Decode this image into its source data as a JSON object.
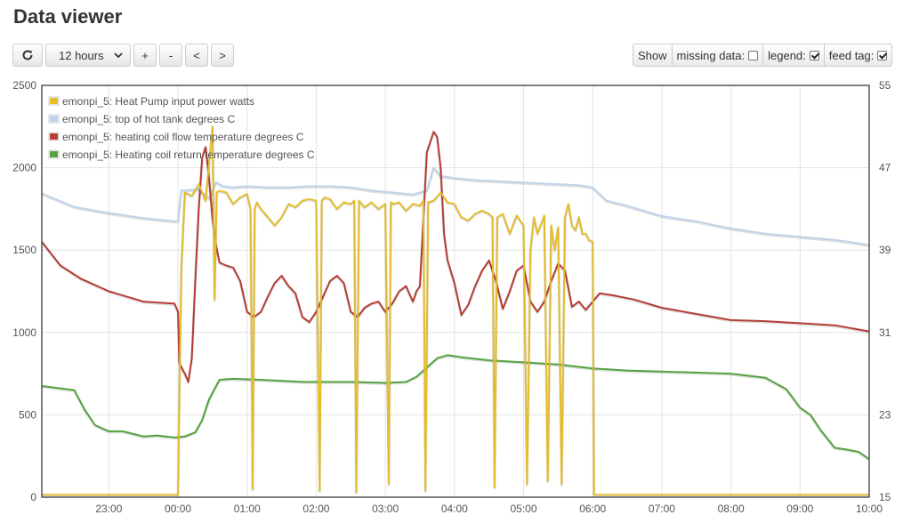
{
  "page": {
    "title": "Data viewer"
  },
  "toolbar": {
    "refresh_icon": "refresh-icon",
    "timespan": "12 hours",
    "zoom_in": "+",
    "zoom_out": "-",
    "pan_left": "<",
    "pan_right": ">"
  },
  "options": {
    "show_label": "Show",
    "missing_data_label": "missing data:",
    "missing_data_checked": false,
    "legend_label": "legend:",
    "legend_checked": true,
    "feed_tag_label": "feed tag:",
    "feed_tag_checked": true
  },
  "chart_data": {
    "type": "line",
    "grid": true,
    "legend_position": "top-left",
    "x_ticks": [
      "23:00",
      "00:00",
      "01:00",
      "02:00",
      "03:00",
      "04:00",
      "05:00",
      "06:00",
      "07:00",
      "08:00",
      "09:00",
      "10:00"
    ],
    "x_tick_hours": [
      -1,
      0,
      1,
      2,
      3,
      4,
      5,
      6,
      7,
      8,
      9,
      10
    ],
    "xlim_hours": [
      -1.97,
      10.0
    ],
    "y_left_ticks": [
      "0",
      "500",
      "1000",
      "1500",
      "2000",
      "2500"
    ],
    "y_left_lim": [
      0,
      2500
    ],
    "y_right_ticks": [
      "15",
      "23",
      "31",
      "39",
      "47",
      "55"
    ],
    "y_right_lim": [
      15,
      55
    ],
    "series": [
      {
        "name": "emonpi_5: Heat Pump input power watts",
        "color": "#e3bd2e",
        "axis": "left",
        "x": [
          -1.97,
          -0.02,
          0.0,
          0.02,
          0.05,
          0.1,
          0.2,
          0.3,
          0.4,
          0.5,
          0.53,
          0.56,
          0.6,
          0.7,
          0.8,
          0.9,
          1.0,
          1.05,
          1.08,
          1.11,
          1.14,
          1.2,
          1.3,
          1.4,
          1.5,
          1.6,
          1.7,
          1.8,
          1.9,
          2.0,
          2.05,
          2.08,
          2.12,
          2.2,
          2.3,
          2.4,
          2.5,
          2.55,
          2.58,
          2.62,
          2.7,
          2.8,
          2.9,
          3.0,
          3.05,
          3.08,
          3.12,
          3.2,
          3.3,
          3.4,
          3.5,
          3.55,
          3.58,
          3.62,
          3.7,
          3.8,
          3.9,
          4.0,
          4.1,
          4.2,
          4.3,
          4.4,
          4.5,
          4.55,
          4.58,
          4.62,
          4.7,
          4.8,
          4.9,
          5.0,
          5.05,
          5.1,
          5.15,
          5.2,
          5.3,
          5.35,
          5.4,
          5.45,
          5.5,
          5.55,
          5.6,
          5.65,
          5.7,
          5.75,
          5.8,
          5.85,
          5.9,
          5.95,
          6.0,
          6.02,
          6.05,
          6.2,
          7.0,
          8.0,
          9.0,
          10.0
        ],
        "y": [
          15,
          15,
          15,
          600,
          1400,
          1850,
          1830,
          1900,
          1800,
          2250,
          1200,
          1850,
          1860,
          1850,
          1780,
          1820,
          1840,
          1750,
          50,
          1750,
          1790,
          1750,
          1700,
          1650,
          1700,
          1780,
          1760,
          1800,
          1810,
          1800,
          40,
          1800,
          1820,
          1810,
          1750,
          1790,
          1780,
          1800,
          30,
          1800,
          1760,
          1790,
          1750,
          1780,
          80,
          1790,
          1780,
          1790,
          1740,
          1780,
          1770,
          1800,
          40,
          1790,
          1800,
          1850,
          1790,
          1780,
          1700,
          1680,
          1720,
          1740,
          1720,
          1700,
          60,
          1700,
          1720,
          1600,
          1710,
          1650,
          80,
          1500,
          1700,
          1600,
          1710,
          100,
          1650,
          1500,
          1640,
          80,
          1700,
          1780,
          1650,
          1620,
          1700,
          1600,
          1600,
          1560,
          1550,
          15,
          15,
          15,
          15,
          15,
          15,
          15
        ]
      },
      {
        "name": "emonpi_5: top of hot tank degrees C",
        "color": "#c0d3ea",
        "axis": "right",
        "x": [
          -1.97,
          -1.5,
          -1.0,
          -0.5,
          -0.05,
          0.0,
          0.05,
          0.3,
          0.45,
          0.55,
          0.65,
          0.8,
          1.0,
          1.3,
          1.6,
          1.9,
          2.2,
          2.5,
          2.8,
          3.1,
          3.4,
          3.6,
          3.7,
          3.8,
          4.0,
          4.3,
          4.6,
          4.9,
          5.2,
          5.5,
          5.8,
          6.0,
          6.2,
          6.5,
          7.0,
          7.5,
          8.0,
          8.5,
          9.0,
          9.5,
          10.0
        ],
        "y": [
          44.5,
          43.2,
          42.6,
          42.1,
          41.8,
          41.8,
          44.8,
          44.9,
          44.0,
          45.6,
          45.2,
          45.1,
          45.2,
          45.1,
          45.1,
          45.2,
          45.2,
          45.1,
          44.8,
          44.6,
          44.4,
          44.8,
          47.0,
          46.2,
          46.0,
          45.8,
          45.7,
          45.6,
          45.5,
          45.4,
          45.3,
          45.1,
          43.8,
          43.3,
          42.3,
          41.8,
          41.1,
          40.6,
          40.3,
          40.0,
          39.5
        ]
      },
      {
        "name": "emonpi_5: heating coil flow temperature degrees C",
        "color": "#b53d35",
        "axis": "right",
        "x": [
          -1.97,
          -1.7,
          -1.4,
          -1.0,
          -0.5,
          -0.05,
          0.0,
          0.02,
          0.1,
          0.15,
          0.2,
          0.25,
          0.3,
          0.35,
          0.4,
          0.45,
          0.5,
          0.55,
          0.6,
          0.7,
          0.8,
          0.9,
          1.0,
          1.1,
          1.2,
          1.3,
          1.4,
          1.5,
          1.6,
          1.7,
          1.8,
          1.9,
          2.0,
          2.1,
          2.2,
          2.3,
          2.4,
          2.5,
          2.6,
          2.7,
          2.8,
          2.9,
          3.0,
          3.1,
          3.2,
          3.3,
          3.4,
          3.45,
          3.5,
          3.6,
          3.7,
          3.75,
          3.8,
          3.85,
          3.9,
          4.0,
          4.1,
          4.2,
          4.3,
          4.4,
          4.5,
          4.6,
          4.7,
          4.8,
          4.9,
          5.0,
          5.1,
          5.2,
          5.3,
          5.4,
          5.5,
          5.6,
          5.7,
          5.8,
          5.9,
          6.0,
          6.1,
          6.3,
          6.6,
          7.0,
          7.5,
          8.0,
          8.5,
          9.0,
          9.5,
          10.0
        ],
        "y": [
          39.8,
          37.5,
          36.2,
          35.0,
          34.0,
          33.8,
          33.0,
          28.0,
          27.0,
          26.2,
          28.5,
          36.0,
          43.0,
          48.0,
          49.0,
          46.0,
          42.0,
          39.5,
          37.8,
          37.5,
          37.3,
          36.0,
          33.0,
          32.5,
          33.0,
          34.5,
          35.8,
          36.5,
          35.5,
          34.8,
          32.5,
          32.0,
          33.0,
          34.5,
          36.0,
          36.5,
          35.8,
          33.0,
          32.5,
          33.4,
          33.8,
          34.0,
          33.0,
          33.8,
          35.0,
          35.5,
          34.0,
          35.0,
          35.5,
          48.5,
          50.5,
          50.0,
          47.0,
          40.5,
          38.0,
          35.8,
          32.7,
          33.7,
          35.5,
          37.0,
          38.0,
          36.0,
          33.3,
          35.0,
          37.0,
          37.5,
          34.0,
          33.0,
          34.0,
          36.0,
          37.7,
          37.0,
          33.5,
          34.0,
          33.2,
          34.0,
          34.8,
          34.6,
          34.2,
          33.4,
          32.8,
          32.2,
          32.1,
          31.9,
          31.7,
          31.1
        ]
      },
      {
        "name": "emonpi_5: Heating coil return temperature degrees C",
        "color": "#54a23e",
        "axis": "right",
        "x": [
          -1.97,
          -1.5,
          -1.35,
          -1.2,
          -1.0,
          -0.8,
          -0.5,
          -0.3,
          -0.05,
          0.1,
          0.25,
          0.35,
          0.45,
          0.6,
          0.8,
          1.2,
          1.8,
          2.5,
          3.0,
          3.3,
          3.45,
          3.6,
          3.75,
          3.9,
          4.1,
          4.5,
          5.0,
          5.5,
          6.0,
          6.5,
          7.0,
          7.5,
          8.0,
          8.5,
          8.8,
          9.0,
          9.15,
          9.3,
          9.5,
          9.7,
          9.85,
          10.0
        ],
        "y": [
          25.8,
          25.4,
          23.5,
          22.0,
          21.4,
          21.4,
          20.9,
          21.0,
          20.8,
          20.9,
          21.3,
          22.5,
          24.5,
          26.4,
          26.5,
          26.4,
          26.2,
          26.2,
          26.1,
          26.2,
          26.7,
          27.6,
          28.5,
          28.8,
          28.6,
          28.3,
          28.1,
          27.9,
          27.5,
          27.3,
          27.2,
          27.1,
          27.0,
          26.6,
          25.5,
          23.7,
          23.0,
          21.5,
          19.8,
          19.6,
          19.4,
          18.7
        ]
      }
    ]
  }
}
